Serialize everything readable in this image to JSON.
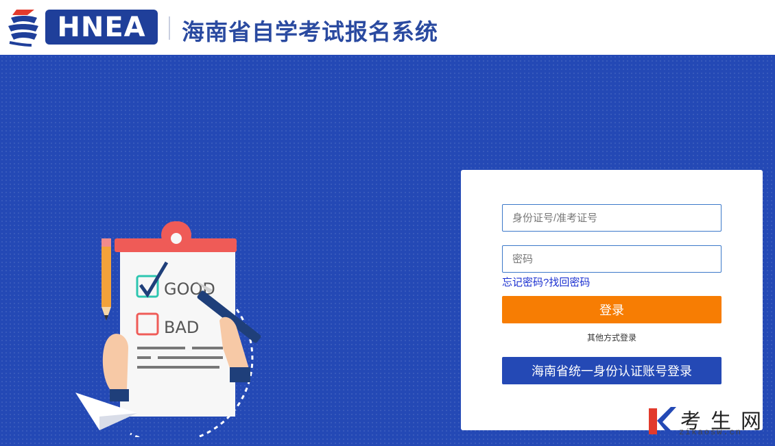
{
  "header": {
    "logo_text": "HNEA",
    "site_title": "海南省自学考试报名系统"
  },
  "login": {
    "id_placeholder": "身份证号/准考证号",
    "password_placeholder": "密码",
    "forgot_link": "忘记密码?找回密码",
    "login_button": "登录",
    "other_methods": "其他方式登录",
    "unified_login_button": "海南省统一身份认证账号登录"
  },
  "illustration": {
    "good_label": "GOOD",
    "bad_label": "BAD"
  },
  "watermark": {
    "text": "考生网",
    "subtext": "zikaosw.cn"
  },
  "colors": {
    "brand_blue": "#2449b5",
    "accent_orange": "#f77d03",
    "link_blue": "#1a2fd0"
  }
}
